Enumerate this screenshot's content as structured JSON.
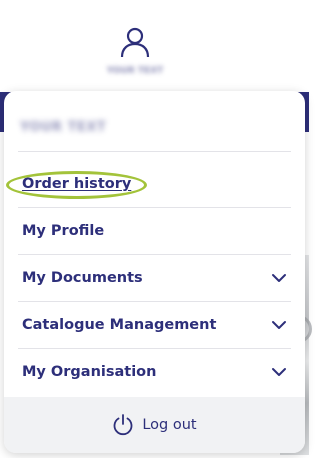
{
  "header": {
    "user_icon": "user-icon",
    "user_name": "YOUR TEXT"
  },
  "dropdown": {
    "user_name": "YOUR TEXT",
    "items": [
      {
        "label": "Order history",
        "kind": "link",
        "icon": null
      },
      {
        "label": "My Profile",
        "kind": "link",
        "icon": null
      },
      {
        "label": "My Documents",
        "kind": "expandable",
        "icon": "chevron-down-icon"
      },
      {
        "label": "Catalogue Management",
        "kind": "expandable",
        "icon": "chevron-down-icon"
      },
      {
        "label": "My Organisation",
        "kind": "expandable",
        "icon": "chevron-down-icon"
      }
    ],
    "logout": {
      "label": "Log out",
      "icon": "power-icon"
    }
  },
  "colors": {
    "brand_navy": "#2d2f7a",
    "highlight_green": "#a3c33a",
    "logout_bg": "#f1f2f4",
    "divider": "#e3e3e8"
  }
}
